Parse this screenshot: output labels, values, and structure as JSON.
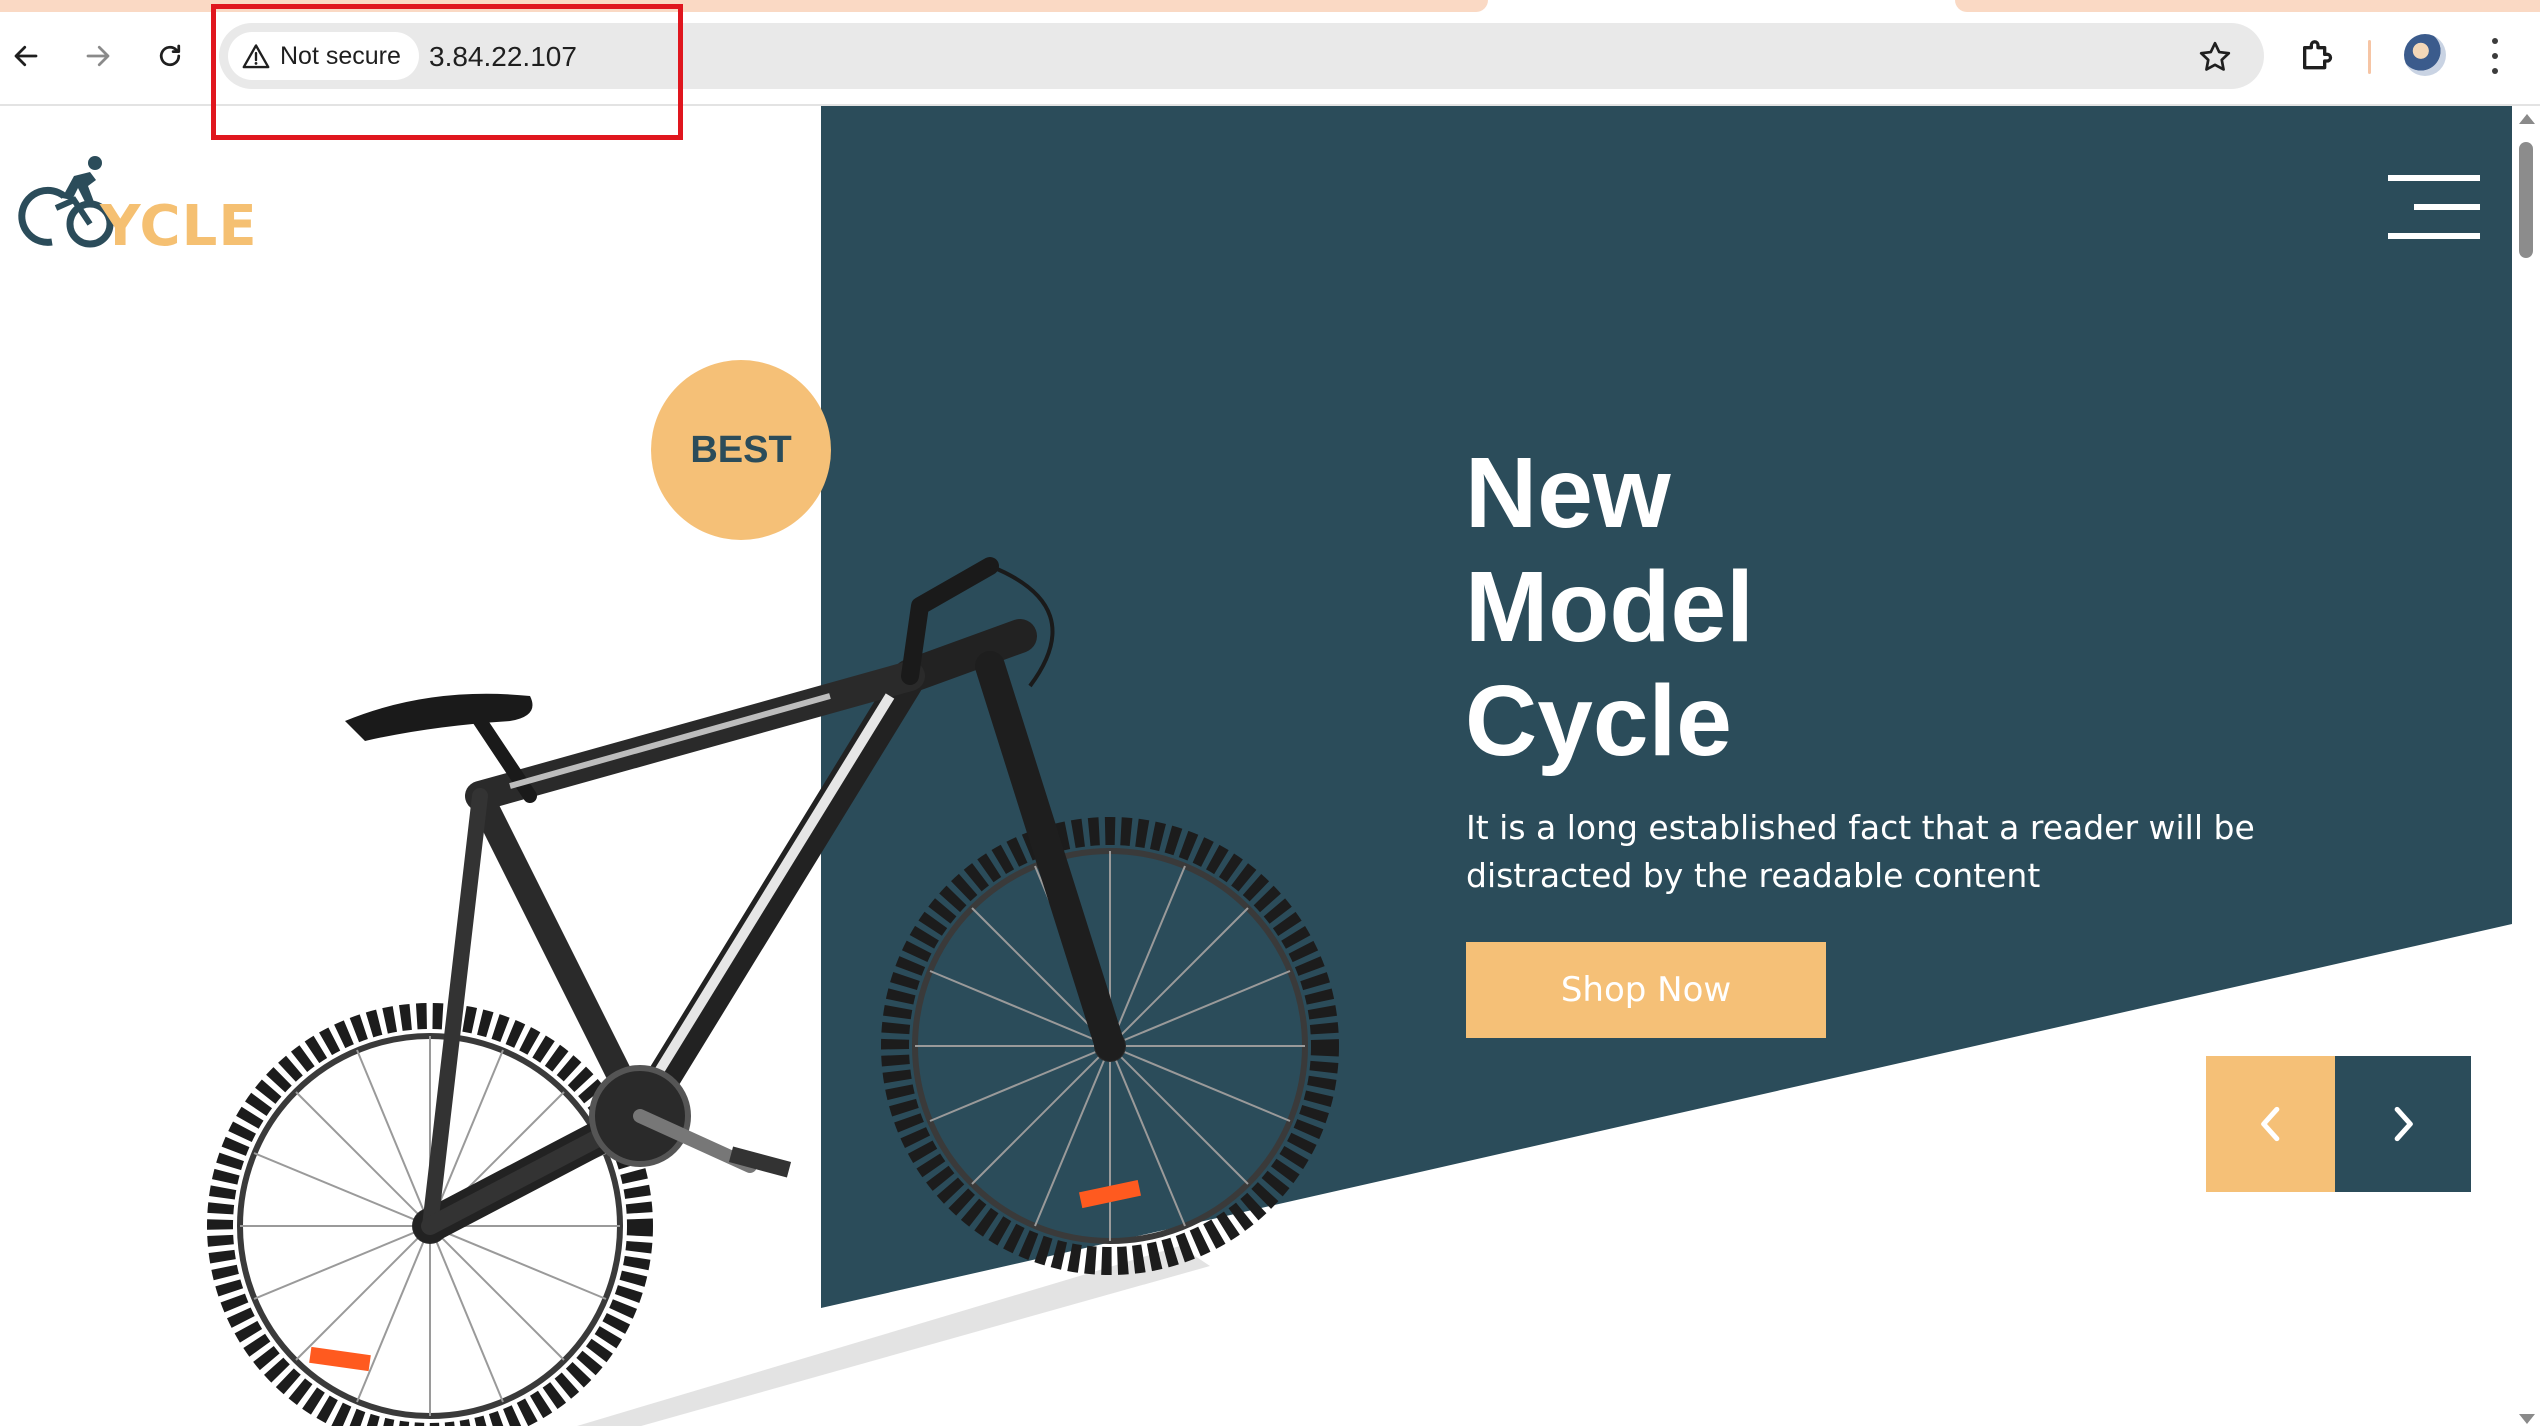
{
  "browser": {
    "security_label": "Not secure",
    "url": "3.84.22.107",
    "icons": [
      "back-arrow-icon",
      "forward-arrow-icon",
      "reload-icon",
      "warning-triangle-icon",
      "bookmark-star-icon",
      "extensions-puzzle-icon",
      "profile-avatar",
      "kebab-menu-icon"
    ]
  },
  "site": {
    "logo_text": "YCLE",
    "badge": "BEST",
    "headline": [
      "New",
      "Model",
      "Cycle"
    ],
    "description": "It is a long established fact that a reader will be distracted by the readable content",
    "cta_label": "Shop Now",
    "colors": {
      "primary": "#2b4c5a",
      "accent": "#f5c077",
      "highlight": "#e0161e"
    }
  }
}
